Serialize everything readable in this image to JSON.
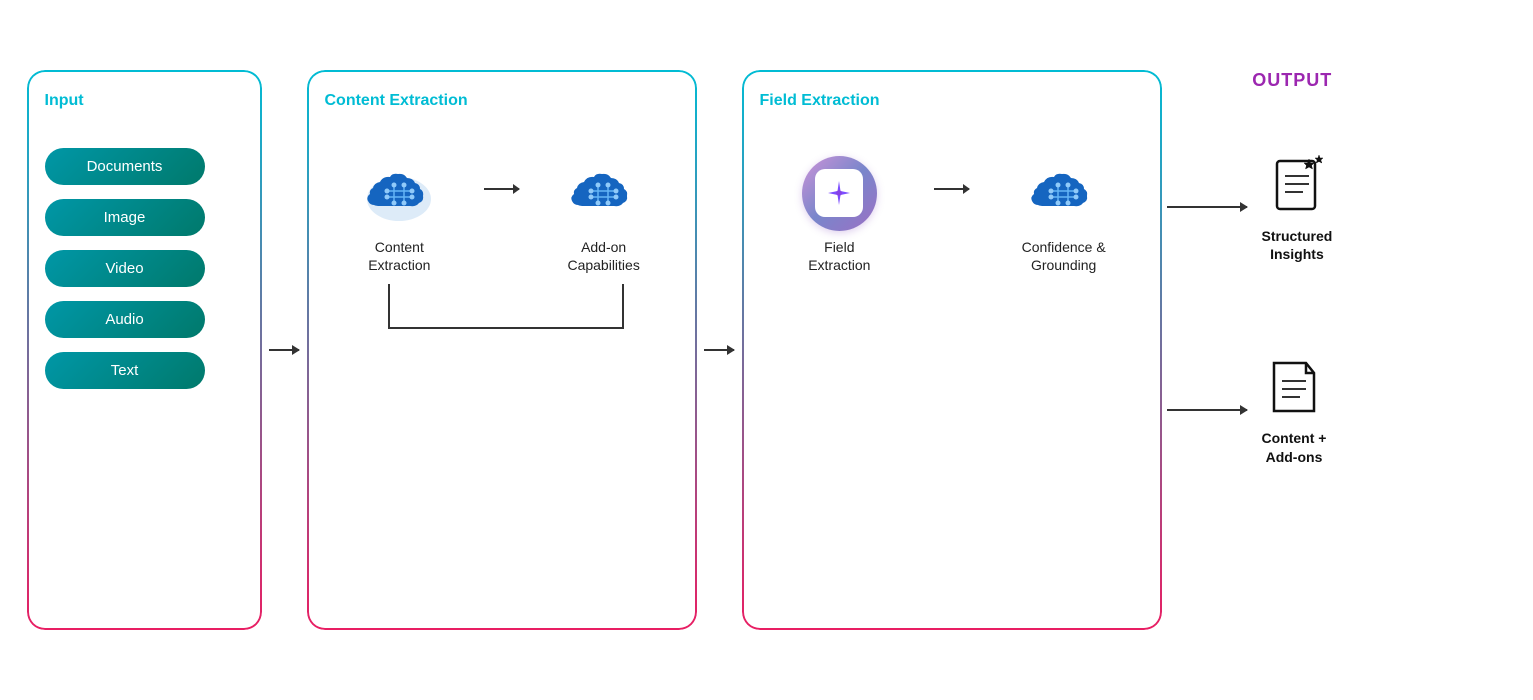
{
  "input": {
    "label": "Input",
    "buttons": [
      "Documents",
      "Image",
      "Video",
      "Audio",
      "Text"
    ]
  },
  "contentExtraction": {
    "label": "Content Extraction",
    "node1": {
      "label": "Content\nExtraction"
    },
    "node2": {
      "label": "Add-on\nCapabilities"
    }
  },
  "fieldExtraction": {
    "label": "Field Extraction",
    "node1": {
      "label": "Field\nExtraction"
    },
    "node2": {
      "label": "Confidence &\nGrounding"
    }
  },
  "output": {
    "label": "OUTPUT",
    "items": [
      {
        "label": "Structured\nInsights"
      },
      {
        "label": "Content +\nAdd-ons"
      }
    ]
  }
}
